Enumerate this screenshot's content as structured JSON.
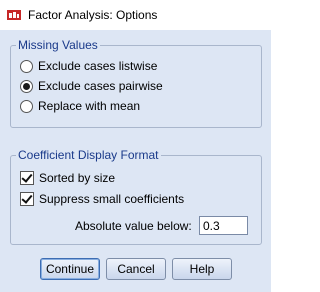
{
  "window": {
    "title": "Factor Analysis: Options"
  },
  "missing_values": {
    "title": "Missing Values",
    "options": [
      {
        "label": "Exclude cases listwise",
        "selected": false
      },
      {
        "label": "Exclude cases pairwise",
        "selected": true
      },
      {
        "label": "Replace with mean",
        "selected": false
      }
    ]
  },
  "coefficient_format": {
    "title": "Coefficient Display Format",
    "sorted_by_size": {
      "label": "Sorted by size",
      "checked": true
    },
    "suppress_small": {
      "label": "Suppress small coefficients",
      "checked": true
    },
    "absolute_value_label": "Absolute value below:",
    "absolute_value": "0.3"
  },
  "buttons": {
    "continue": "Continue",
    "cancel": "Cancel",
    "help": "Help"
  },
  "colors": {
    "dialog_background": "#dde6f4",
    "group_title": "#1a3a8a",
    "button_border": "#7e8ea8"
  },
  "icons": {
    "app": "spss-window-icon"
  }
}
